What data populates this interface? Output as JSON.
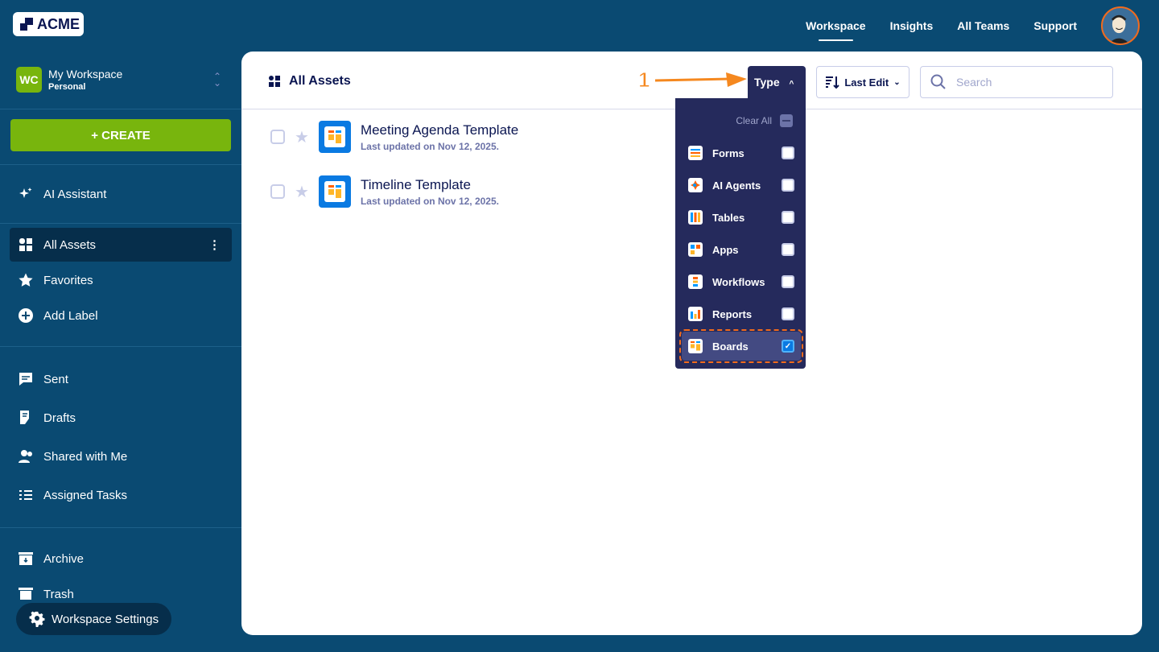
{
  "brand": {
    "logo_text": "ACME"
  },
  "topnav": {
    "items": [
      "Workspace",
      "Insights",
      "All Teams",
      "Support"
    ],
    "active": "Workspace"
  },
  "workspace": {
    "initials": "WC",
    "name": "My Workspace",
    "type": "Personal"
  },
  "sidebar": {
    "create_label": "+ CREATE",
    "ai_label": "AI Assistant",
    "items": [
      {
        "label": "All Assets"
      },
      {
        "label": "Favorites"
      },
      {
        "label": "Add Label"
      },
      {
        "label": "Sent"
      },
      {
        "label": "Drafts"
      },
      {
        "label": "Shared with Me"
      },
      {
        "label": "Assigned Tasks"
      },
      {
        "label": "Archive"
      },
      {
        "label": "Trash"
      }
    ],
    "settings_label": "Workspace Settings",
    "more_icon": "⋮"
  },
  "main": {
    "title": "All Assets",
    "type_label": "Type",
    "sort_label": "Last Edit",
    "search_placeholder": "Search",
    "assets": [
      {
        "name": "Meeting Agenda Template",
        "updated": "Last updated on Nov 12, 2025."
      },
      {
        "name": "Timeline Template",
        "updated": "Last updated on Nov 12, 2025."
      }
    ]
  },
  "type_dropdown": {
    "clear_label": "Clear All",
    "options": [
      {
        "label": "Forms",
        "checked": false
      },
      {
        "label": "AI Agents",
        "checked": false
      },
      {
        "label": "Tables",
        "checked": false
      },
      {
        "label": "Apps",
        "checked": false
      },
      {
        "label": "Workflows",
        "checked": false
      },
      {
        "label": "Reports",
        "checked": false
      },
      {
        "label": "Boards",
        "checked": true
      }
    ]
  },
  "annotation": {
    "step": "1"
  },
  "colors": {
    "bg": "#0a4a72",
    "accent_green": "#78b50d",
    "dropdown": "#252a5c",
    "highlight": "#f16b1d"
  }
}
